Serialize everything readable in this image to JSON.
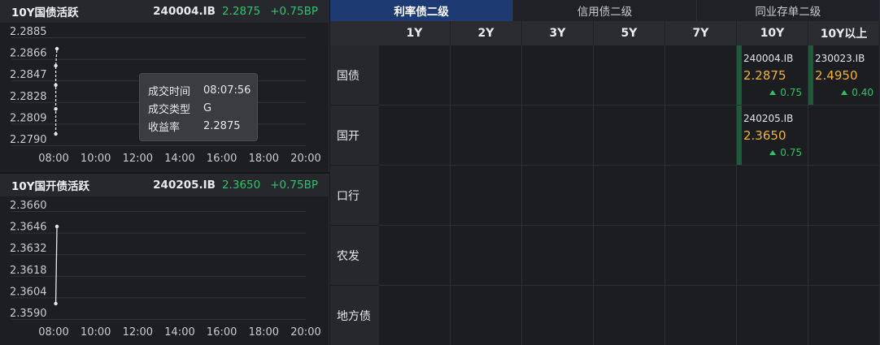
{
  "charts": [
    {
      "title": "10Y国债活跃",
      "code": "240004.IB",
      "price": "2.2875",
      "change": "+0.75BP",
      "tooltip": {
        "time_label": "成交时间",
        "time": "08:07:56",
        "type_label": "成交类型",
        "type": "G",
        "yield_label": "收益率",
        "yield": "2.2875"
      }
    },
    {
      "title": "10Y国开债活跃",
      "code": "240205.IB",
      "price": "2.3650",
      "change": "+0.75BP"
    }
  ],
  "chart_data": [
    {
      "type": "line",
      "title": "10Y国债活跃",
      "xlabel": "",
      "ylabel": "",
      "x_ticks": [
        "08:00",
        "10:00",
        "12:00",
        "14:00",
        "16:00",
        "18:00",
        "20:00"
      ],
      "y_ticks": [
        "2.2885",
        "2.2866",
        "2.2847",
        "2.2828",
        "2.2809",
        "2.2790"
      ],
      "ylim": [
        2.279,
        2.2885
      ],
      "xlim": [
        "08:00",
        "20:00"
      ],
      "grid": true,
      "series": [
        {
          "x": [
            "08:06",
            "08:06",
            "08:06",
            "08:06",
            "08:07"
          ],
          "y": [
            2.28,
            2.2822,
            2.2843,
            2.286,
            2.2875
          ]
        }
      ],
      "line_color": "#e6e8ec"
    },
    {
      "type": "line",
      "title": "10Y国开债活跃",
      "xlabel": "",
      "ylabel": "",
      "x_ticks": [
        "08:00",
        "10:00",
        "12:00",
        "14:00",
        "16:00",
        "18:00",
        "20:00"
      ],
      "y_ticks": [
        "2.3660",
        "2.3646",
        "2.3632",
        "2.3618",
        "2.3604",
        "2.3590"
      ],
      "ylim": [
        2.359,
        2.366
      ],
      "xlim": [
        "08:00",
        "20:00"
      ],
      "grid": true,
      "series": [
        {
          "x": [
            "08:06",
            "08:07"
          ],
          "y": [
            2.36,
            2.365
          ]
        }
      ],
      "line_color": "#e6e8ec"
    }
  ],
  "tabs": [
    {
      "label": "利率债二级",
      "active": true
    },
    {
      "label": "信用债二级",
      "active": false
    },
    {
      "label": "同业存单二级",
      "active": false
    }
  ],
  "columns": [
    "1Y",
    "2Y",
    "3Y",
    "5Y",
    "7Y",
    "10Y",
    "10Y以上"
  ],
  "rows": [
    "国债",
    "国开",
    "口行",
    "农发",
    "地方债"
  ],
  "quotes": [
    {
      "row": 0,
      "col": 5,
      "code": "240004.IB",
      "yield": "2.2875",
      "change": "0.75"
    },
    {
      "row": 0,
      "col": 6,
      "code": "230023.IB",
      "yield": "2.4950",
      "change": "0.40"
    },
    {
      "row": 1,
      "col": 5,
      "code": "240205.IB",
      "yield": "2.3650",
      "change": "0.75"
    }
  ],
  "colors": {
    "up_green": "#2fc46a",
    "yield_orange": "#f2b23a",
    "active_tab": "#1e3a72"
  }
}
